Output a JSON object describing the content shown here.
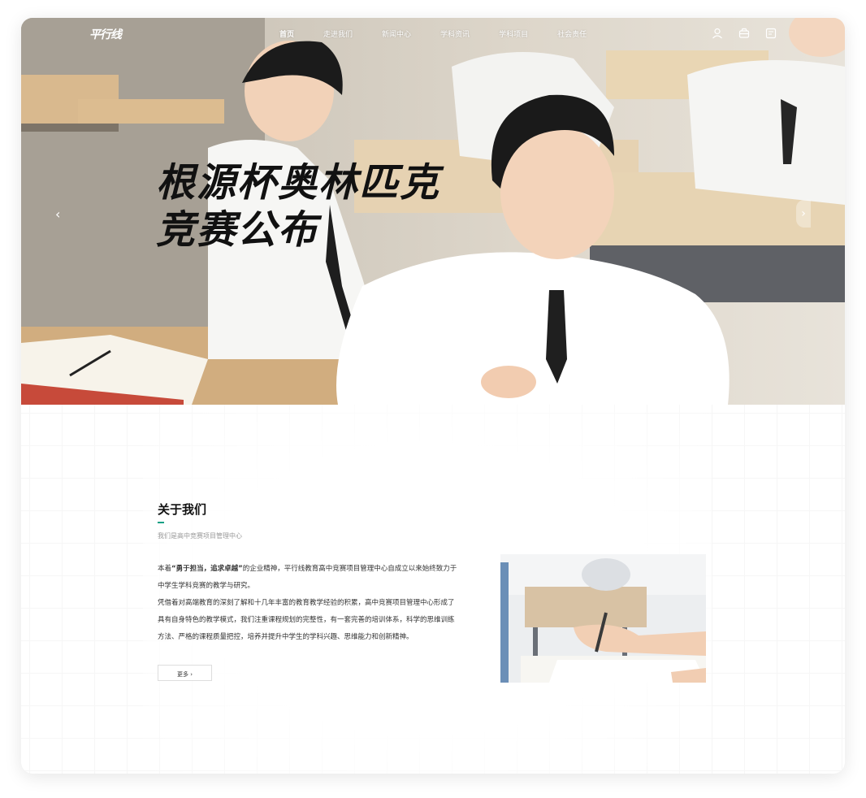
{
  "nav": {
    "logo": "平行线",
    "items": [
      {
        "label": "首页",
        "active": true
      },
      {
        "label": "走进我们",
        "active": false
      },
      {
        "label": "新闻中心",
        "active": false
      },
      {
        "label": "学科资讯",
        "active": false
      },
      {
        "label": "学科项目",
        "active": false
      },
      {
        "label": "社会责任",
        "active": false
      }
    ],
    "icons": [
      "user-icon",
      "cart-icon",
      "document-icon"
    ]
  },
  "hero": {
    "title_line1": "根源杯奥林匹克",
    "title_line2": "竞赛公布",
    "prev": "‹",
    "next": "›",
    "slides": 2,
    "active_slide": 1
  },
  "about": {
    "title": "关于我们",
    "subtitle": "我们是高中竞赛项目管理中心",
    "p1_prefix": "本着",
    "p1_bold": "“勇于担当，追求卓越”",
    "p1_suffix": "的企业精神，平行线教育高中竞赛项目管理中心自成立以来始终致力于中学生学科竞赛的教学与研究。",
    "p2": "凭借着对高端教育的深刻了解和十几年丰富的教育教学经验的积累，高中竞赛项目管理中心形成了具有自身特色的教学模式，我们注重课程规划的完整性，有一套完善的培训体系，科学的思维训练方法、严格的课程质量把控，培养并提升中学生的学科兴趣、思维能力和创新精神。",
    "more": "更多 ›"
  },
  "colors": {
    "accent": "#16a085",
    "title": "#111111",
    "text": "#333333",
    "subtext": "#999999"
  }
}
